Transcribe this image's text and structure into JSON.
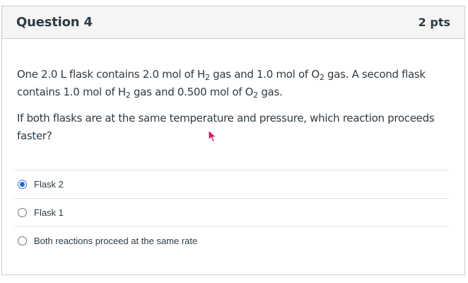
{
  "question": {
    "title": "Question 4",
    "points": "2 pts",
    "paragraph1": {
      "p1": "One 2.0 L flask contains 2.0 mol of H",
      "s1": "2",
      "p2": " gas and 1.0 mol of O",
      "s2": "2",
      "p3": " gas. A second flask contains 1.0 mol of H",
      "s3": "2",
      "p4": " gas and 0.500 mol of O",
      "s4": "2",
      "p5": " gas."
    },
    "paragraph2": "If both flasks are at the same temperature and pressure, which reaction proceeds faster?"
  },
  "answers": [
    {
      "label": "Flask 2",
      "selected": true
    },
    {
      "label": "Flask 1",
      "selected": false
    },
    {
      "label": "Both reactions proceed at the same rate",
      "selected": false
    }
  ],
  "colors": {
    "cursor": "#d6185a",
    "radio_selected": "#1c6bd6"
  }
}
